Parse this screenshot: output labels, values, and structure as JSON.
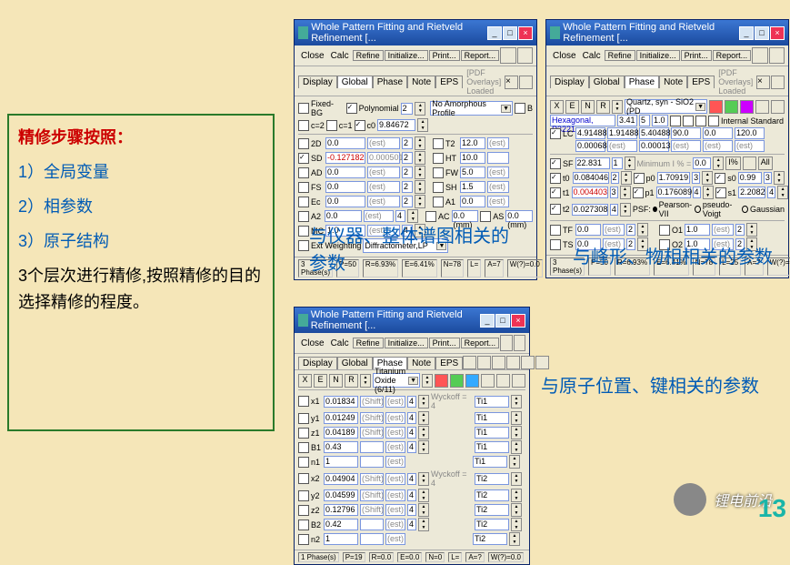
{
  "box": {
    "title": "精修步骤按照：",
    "i1": "1）全局变量",
    "i2": "2）相参数",
    "i3": "3）原子结构",
    "desc": "3个层次进行精修,按照精修的目的选择精修的程度。"
  },
  "wtitle": "Whole Pattern Fitting and Rietveld Refinement [...",
  "menu": {
    "close": "Close",
    "calc": "Calc",
    "refine": "Refine",
    "init": "Initialize...",
    "print": "Print...",
    "report": "Report..."
  },
  "tabs": {
    "display": "Display",
    "global": "Global",
    "phase": "Phase",
    "note": "Note",
    "eps": "EPS",
    "pdf": "[PDF Overlays] Loaded"
  },
  "w1": {
    "r0": {
      "fbg": "Fixed-BG",
      "poly": "Polynomial",
      "pv": "2",
      "amo": "No Amorphous Profile",
      "b": "B"
    },
    "r1": {
      "c2": "c=2",
      "c1": "c=1",
      "c0": "c0",
      "v": "9.84672"
    },
    "rows": [
      {
        "n": "2D",
        "v": "0.0",
        "t": "(est)",
        "s": "2"
      },
      {
        "n": "SD",
        "v": "-0.127182",
        "t": "0.000501",
        "s": "2"
      },
      {
        "n": "AD",
        "v": "0.0",
        "t": "(est)",
        "s": "2"
      },
      {
        "n": "FS",
        "v": "0.0",
        "t": "(est)",
        "s": "2"
      },
      {
        "n": "Ec",
        "v": "0.0",
        "t": "(est)",
        "s": "2"
      },
      {
        "n": "A2",
        "v": "0.0",
        "t": "(est)",
        "s": "4"
      },
      {
        "n": "MC",
        "v": "1.0",
        "t": "(est)",
        "s": "4"
      }
    ],
    "col2": [
      {
        "n": "T2",
        "v": "12.0",
        "t": "(est)"
      },
      {
        "n": "HT",
        "v": "10.0",
        "t": ""
      },
      {
        "n": "FW",
        "v": "5.0",
        "t": "(est)"
      },
      {
        "n": "SH",
        "v": "1.5",
        "t": "(est)"
      },
      {
        "n": "A1",
        "v": "0.0",
        "t": "(est)"
      }
    ],
    "ac": {
      "l": "AC",
      "v": "0.0 (mm)",
      "as": "AS",
      "asv": "0.0 (mm)"
    },
    "ew": {
      "l": "Ext Weighting",
      "v": "Diffractometer,LP"
    },
    "stat": [
      "3 Phase(s)",
      "P=50",
      "R=6.93%",
      "E=6.41%",
      "N=78",
      "L=",
      "A=7",
      "W(?)=0.0"
    ]
  },
  "w2": {
    "tbar": [
      "X",
      "E",
      "N",
      "R"
    ],
    "dd": "Quartz, syn - SiO2 (PD",
    "r0": {
      "n": "Hexagonal, P3221",
      "a": "3.41",
      "b": "5",
      "c": "1.0",
      "is": "Internal Standard"
    },
    "rows": [
      {
        "n": "LC",
        "v1": "4.91488",
        "v2": "1.91488",
        "v3": "5.40488",
        "v4": "90.0",
        "v5": "0.0",
        "v6": "120.0"
      },
      {
        "n": "",
        "v1": "0.000684",
        "v2": "(est)",
        "v3": "0.000139",
        "v4": "(est)",
        "v5": "(est)",
        "v6": "(est)"
      }
    ],
    "sf": {
      "n": "SF",
      "v": "22.831",
      "s": "1",
      "ml": "Minimum I % =",
      "mv": "0.0",
      "ix": "I%",
      "all": "All"
    },
    "prows": [
      {
        "n": "t0",
        "v": "0.084046",
        "s": "2",
        "pn": "p0",
        "pv": "1.70919",
        "ps": "3",
        "sn": "s0",
        "sv": "0.99",
        "ss": "3"
      },
      {
        "n": "t1",
        "v": "0.004403",
        "s": "3",
        "pn": "p1",
        "pv": "0.176089",
        "ps": "4",
        "sn": "s1",
        "sv": "2.2082",
        "ss": "4"
      },
      {
        "n": "t2",
        "v": "0.027308",
        "s": "4",
        "pn": "PSF:",
        "pv": "Pearson-VII",
        "po": "pseudo-Voigt",
        "pg": "Gaussian"
      }
    ],
    "brows": [
      {
        "n": "TF",
        "v": "0.0",
        "t": "(est)",
        "s": "2",
        "n2": "O1",
        "v2": "1.0",
        "t2": "(est)",
        "s2": "2"
      },
      {
        "n": "TS",
        "v": "0.0",
        "t": "(est)",
        "s": "2",
        "n2": "O2",
        "v2": "1.0",
        "t2": "(est)",
        "s2": "2"
      }
    ],
    "stat": [
      "3 Phase(s)",
      "P=50",
      "R=6.93%",
      "E=6.41%",
      "N=78",
      "L=25",
      "A=7",
      "W(?)=0.0"
    ]
  },
  "w3": {
    "tbar": [
      "X",
      "E",
      "N",
      "R"
    ],
    "dd": "Titanium Oxide (6/11)",
    "rows": [
      {
        "n": "x1",
        "v": "0.01834",
        "t": "(Shift)",
        "tt": "(est)",
        "s": "4",
        "w": "Wyckoff = 4",
        "a": "Ti1 <Ti >"
      },
      {
        "n": "y1",
        "v": "0.01249",
        "t": "(Shift)",
        "tt": "(est)",
        "s": "4",
        "w": "",
        "a": "Ti1 <Ti >"
      },
      {
        "n": "z1",
        "v": "0.04189",
        "t": "(Shift)",
        "tt": "(est)",
        "s": "4",
        "w": "",
        "a": "Ti1 <Ti >"
      },
      {
        "n": "B1",
        "v": "0.43",
        "t": "",
        "tt": "(est)",
        "s": "4",
        "w": "",
        "a": "Ti1 <Ti >"
      },
      {
        "n": "n1",
        "v": "1",
        "t": "",
        "tt": "(est)",
        "s": "",
        "w": "",
        "a": "Ti1 <Ti >"
      },
      {
        "n": "x2",
        "v": "0.04904",
        "t": "(Shift)",
        "tt": "(est)",
        "s": "4",
        "w": "Wyckoff = 4",
        "a": "Ti2 <Ti >"
      },
      {
        "n": "y2",
        "v": "0.04599",
        "t": "(Shift)",
        "tt": "(est)",
        "s": "4",
        "w": "",
        "a": "Ti2 <Ti >"
      },
      {
        "n": "z2",
        "v": "0.12796",
        "t": "(Shift)",
        "tt": "(est)",
        "s": "4",
        "w": "",
        "a": "Ti2 <Ti >"
      },
      {
        "n": "B2",
        "v": "0.42",
        "t": "",
        "tt": "(est)",
        "s": "4",
        "w": "",
        "a": "Ti2 <Ti >"
      },
      {
        "n": "n2",
        "v": "1",
        "t": "",
        "tt": "(est)",
        "s": "",
        "w": "",
        "a": "Ti2 <Ti >"
      }
    ],
    "stat": [
      "1 Phase(s)",
      "P=19",
      "R=0.0",
      "E=0.0",
      "N=0",
      "L=",
      "A=?",
      "W(?)=0.0"
    ]
  },
  "cap1": "与仪器、整体谱图相关的参数",
  "cap2": "与峰形、物相相关的参数",
  "cap3": "与原子位置、键相关的参数",
  "wm": "锂电前沿",
  "pg": "13"
}
